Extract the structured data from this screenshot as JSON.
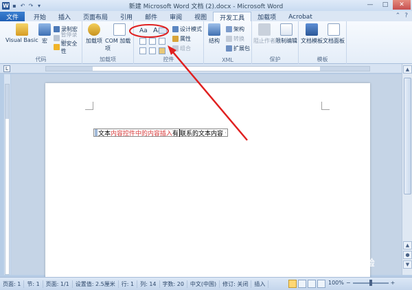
{
  "titlebar": {
    "title": "新建 Microsoft Word 文档 (2).docx - Microsoft Word",
    "app_icon": "W"
  },
  "tabs": [
    {
      "label": "文件"
    },
    {
      "label": "开始"
    },
    {
      "label": "插入"
    },
    {
      "label": "页面布局"
    },
    {
      "label": "引用"
    },
    {
      "label": "邮件"
    },
    {
      "label": "审阅"
    },
    {
      "label": "视图"
    },
    {
      "label": "开发工具"
    },
    {
      "label": "加载项"
    },
    {
      "label": "Acrobat"
    }
  ],
  "active_tab": "开发工具",
  "ribbon": {
    "code": {
      "label": "代码",
      "visual_basic": "Visual Basic",
      "macro": "宏",
      "record_macro": "录制宏",
      "pause_record": "暂停录制",
      "macro_security": "宏安全性"
    },
    "addins": {
      "label": "加载项",
      "addins": "加载项",
      "com_addins": "COM 加载项"
    },
    "controls": {
      "label": "控件",
      "rich_text": "Aa",
      "plain_text": "Aa",
      "design_mode": "设计模式",
      "properties": "属性",
      "group": "组合"
    },
    "xml": {
      "label": "XML",
      "structure": "结构",
      "schema": "架构",
      "transform": "转换",
      "expansion_pack": "扩展包"
    },
    "protect": {
      "label": "保护",
      "block_authors": "阻止作者",
      "restrict_editing": "限制编辑"
    },
    "templates": {
      "label": "模板",
      "doc_template": "文档模板",
      "doc_panel": "文档面板"
    }
  },
  "document": {
    "cc_prefix": "文本",
    "cc_red": "内容控件中的内容插入",
    "cc_black": "有",
    "cc_after_caret": "联系的文本内容",
    "cc_tail": "·"
  },
  "status": {
    "page": "页面: 1",
    "section": "节: 1",
    "page_of": "页面: 1/1",
    "position": "设置值: 2.5厘米",
    "line": "行: 1",
    "column": "列: 14",
    "words": "字数: 20",
    "language": "中文(中国)",
    "track": "修订: 关闭",
    "insert": "插入",
    "zoom": "100%"
  },
  "colors": {
    "annotation_red": "#e02020",
    "file_tab": "#2a6bc4"
  },
  "watermark": "Bai 经验"
}
